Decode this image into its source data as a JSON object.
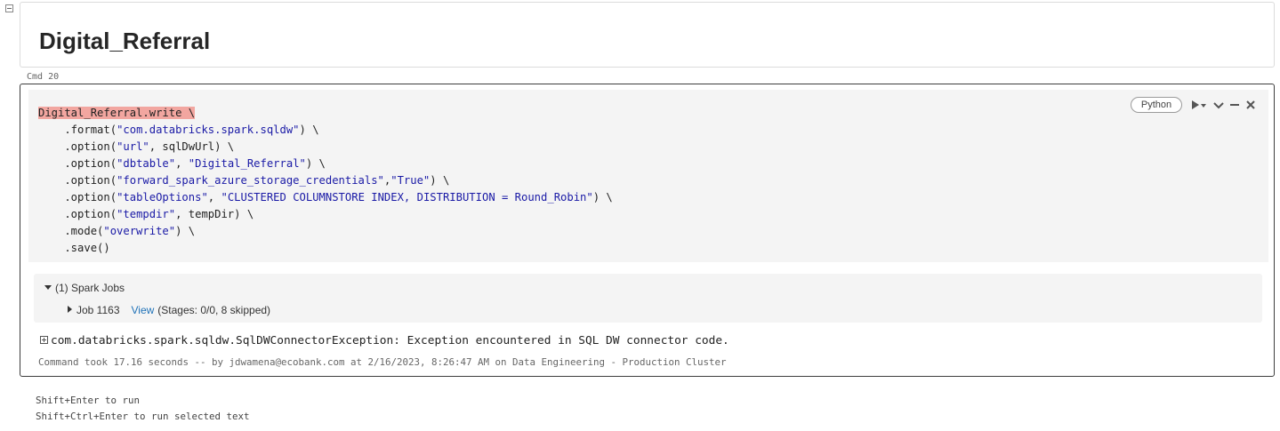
{
  "markdown_cell": {
    "title": "Digital_Referral"
  },
  "code_cell": {
    "command_label": "Cmd 20",
    "language": "Python",
    "code_lines": [
      [
        {
          "t": "Digital_Referral.write \\",
          "c": "hl"
        }
      ],
      [
        {
          "t": "    .format("
        },
        {
          "t": "\"com.databricks.spark.sqldw\"",
          "c": "str"
        },
        {
          "t": ") \\"
        }
      ],
      [
        {
          "t": "    .option("
        },
        {
          "t": "\"url\"",
          "c": "str"
        },
        {
          "t": ", sqlDwUrl) \\"
        }
      ],
      [
        {
          "t": "    .option("
        },
        {
          "t": "\"dbtable\"",
          "c": "str"
        },
        {
          "t": ", "
        },
        {
          "t": "\"Digital_Referral\"",
          "c": "str"
        },
        {
          "t": ") \\"
        }
      ],
      [
        {
          "t": "    .option("
        },
        {
          "t": "\"forward_spark_azure_storage_credentials\"",
          "c": "str"
        },
        {
          "t": ","
        },
        {
          "t": "\"True\"",
          "c": "str"
        },
        {
          "t": ") \\"
        }
      ],
      [
        {
          "t": "    .option("
        },
        {
          "t": "\"tableOptions\"",
          "c": "str"
        },
        {
          "t": ", "
        },
        {
          "t": "\"CLUSTERED COLUMNSTORE INDEX, DISTRIBUTION = Round_Robin\"",
          "c": "str"
        },
        {
          "t": ") \\"
        }
      ],
      [
        {
          "t": "    .option("
        },
        {
          "t": "\"tempdir\"",
          "c": "str"
        },
        {
          "t": ", tempDir) \\"
        }
      ],
      [
        {
          "t": "    .mode("
        },
        {
          "t": "\"overwrite\"",
          "c": "str"
        },
        {
          "t": ") \\"
        }
      ],
      [
        {
          "t": "    .save()"
        }
      ]
    ],
    "spark_jobs": {
      "header": "(1) Spark Jobs",
      "job_label": "Job 1163",
      "job_link": "View",
      "job_stages": "(Stages: 0/0, 8 skipped)"
    },
    "error_text": "com.databricks.spark.sqldw.SqlDWConnectorException: Exception encountered in SQL DW connector code.",
    "command_meta": "Command took 17.16 seconds -- by jdwamena@ecobank.com at 2/16/2023, 8:26:47 AM on Data Engineering - Production Cluster"
  },
  "hints": {
    "run": "Shift+Enter to run",
    "run_selected": "Shift+Ctrl+Enter to run selected text"
  },
  "colors": {
    "highlight": "#f2a6a0",
    "string": "#1a1aa6",
    "link": "#1f72b8",
    "cell_border_active": "#3d3d3d"
  },
  "icons": {
    "collapse": "minus-square-icon",
    "run": "play-icon",
    "chevron": "chevron-down-icon",
    "minimize": "minus-icon",
    "close": "close-icon",
    "expand": "plus-square-icon"
  }
}
